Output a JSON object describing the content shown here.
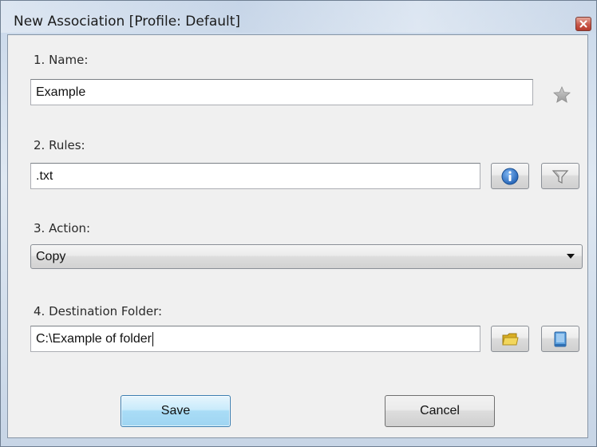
{
  "window": {
    "title": "New Association [Profile: Default]"
  },
  "form": {
    "name_label": "1. Name:",
    "name_value": "Example",
    "rules_label": "2. Rules:",
    "rules_value": ".txt",
    "action_label": "3. Action:",
    "action_selected": "Copy",
    "destination_label": "4. Destination Folder:",
    "destination_value": "C:\\Example of folder"
  },
  "buttons": {
    "save_label": "Save",
    "cancel_label": "Cancel"
  },
  "icons": {
    "favorite": "star-icon",
    "info": "info-icon",
    "filter": "filter-icon",
    "browse": "folder-icon",
    "open": "book-icon",
    "close": "close-icon",
    "dropdown": "chevron-down-icon"
  },
  "colors": {
    "info_blue": "#2c6fc2",
    "folder_yellow": "#e8c23a",
    "save_button": "#a9dcf6",
    "close_red": "#c9584a"
  }
}
